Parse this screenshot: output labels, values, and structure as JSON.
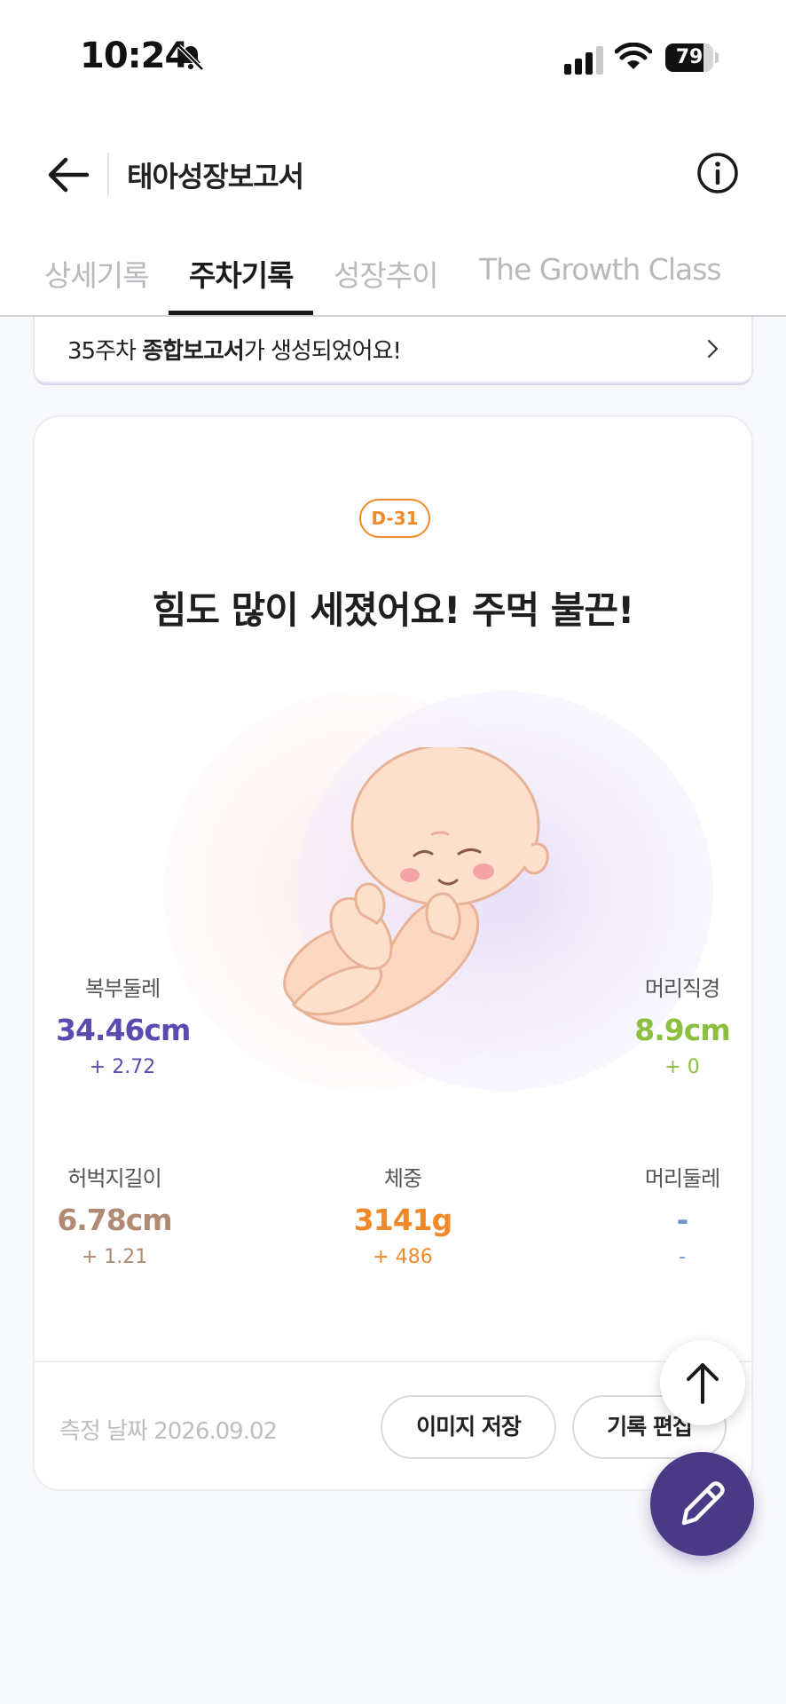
{
  "status_bar": {
    "time": "10:24",
    "battery": "79",
    "battery_level": 0.79
  },
  "header": {
    "title": "태아성장보고서"
  },
  "tabs": [
    {
      "label": "상세기록",
      "active": false
    },
    {
      "label": "주차기록",
      "active": true
    },
    {
      "label": "성장추이",
      "active": false
    },
    {
      "label": "The Growth Class",
      "active": false
    }
  ],
  "banner": {
    "prefix": "35주차 ",
    "bold": "종합보고서",
    "suffix": "가 생성되었어요!"
  },
  "card": {
    "dday": "D-31",
    "headline": "힘도 많이 세졌어요! 주먹 불끈!",
    "metrics": {
      "abdominal": {
        "label": "복부둘레",
        "value": "34.46cm",
        "delta": "+ 2.72",
        "color": "#5b4ab0"
      },
      "bpd": {
        "label": "머리직경",
        "value": "8.9cm",
        "delta": "+ 0",
        "color": "#8cbf3f"
      },
      "femur": {
        "label": "허벅지길이",
        "value": "6.78cm",
        "delta": "+ 1.21",
        "color": "#b08a72"
      },
      "weight": {
        "label": "체중",
        "value": "3141g",
        "delta": "+ 486",
        "color": "#f08a28"
      },
      "head": {
        "label": "머리둘레",
        "value": "-",
        "delta": "-",
        "color": "#6f97c9"
      }
    },
    "measure_date": "측정 날짜 2026.09.02",
    "save_image": "이미지 저장",
    "edit_record": "기록 편집"
  },
  "icons": {
    "back": "back-arrow-icon",
    "info": "info-icon",
    "scroll_top": "arrow-up-icon",
    "edit": "pencil-icon"
  },
  "colors": {
    "accent": "#4a3a86",
    "dday": "#f08a28"
  }
}
